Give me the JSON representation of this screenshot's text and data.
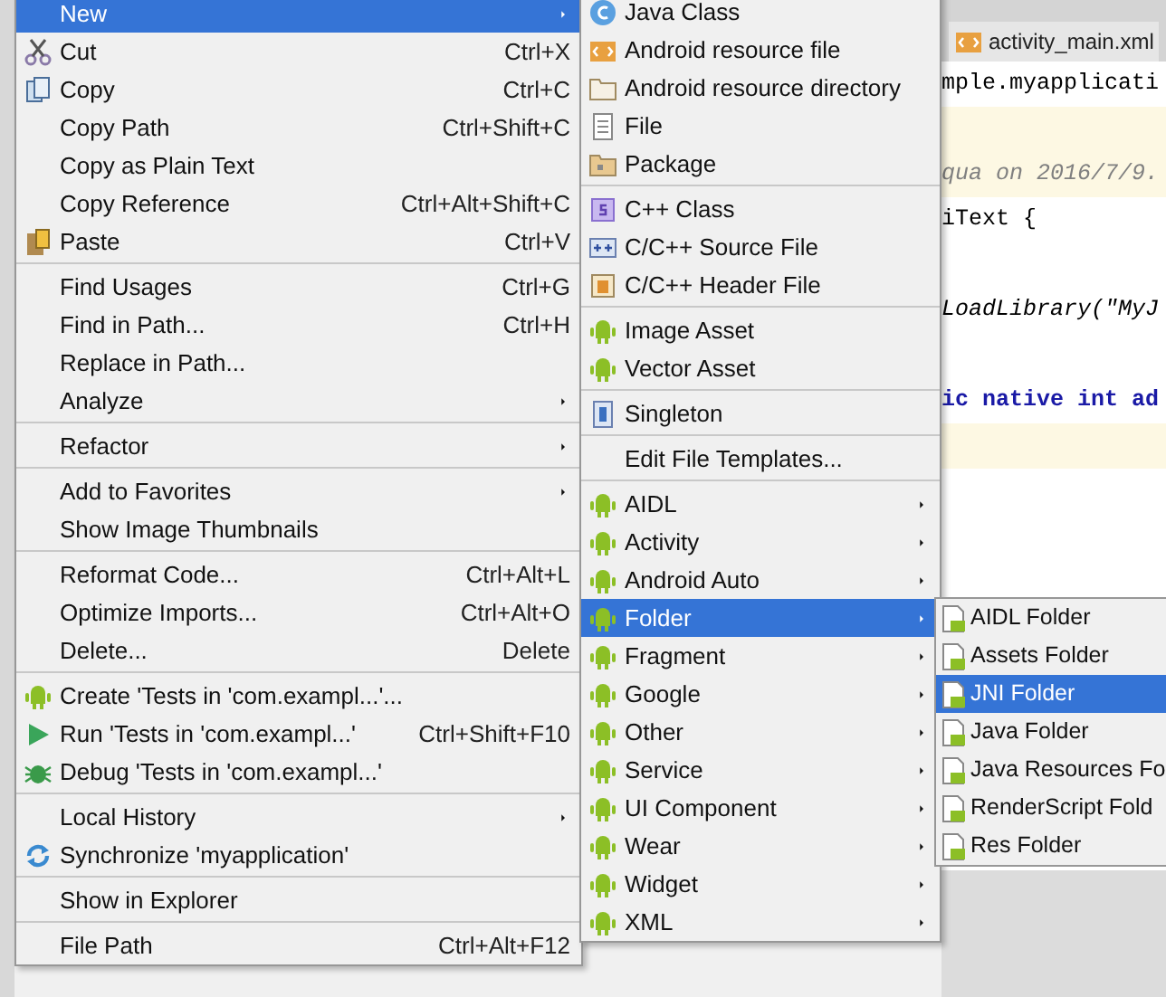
{
  "editor": {
    "tab": "activity_main.xml",
    "lines": [
      {
        "kind": "code",
        "text": "mple.myapplicati"
      },
      {
        "kind": "blank_highlight"
      },
      {
        "kind": "comment",
        "text": "qua on 2016/7/9."
      },
      {
        "kind": "code",
        "text": "iText {"
      },
      {
        "kind": "blank"
      },
      {
        "kind": "italic",
        "text": "LoadLibrary(\"MyJ"
      },
      {
        "kind": "blank"
      },
      {
        "kind": "keyword",
        "text": "ic native int ad"
      },
      {
        "kind": "blank_highlight"
      }
    ]
  },
  "context_menu": {
    "items": [
      {
        "kind": "item",
        "label": "New",
        "submenu": true,
        "selected": true
      },
      {
        "kind": "item",
        "label": "Cut",
        "shortcut": "Ctrl+X",
        "selected": false
      },
      {
        "kind": "item",
        "label": "Copy",
        "shortcut": "Ctrl+C",
        "selected": false
      },
      {
        "kind": "item",
        "label": "Copy Path",
        "shortcut": "Ctrl+Shift+C",
        "selected": false
      },
      {
        "kind": "item",
        "label": "Copy as Plain Text",
        "selected": false
      },
      {
        "kind": "item",
        "label": "Copy Reference",
        "shortcut": "Ctrl+Alt+Shift+C",
        "selected": false
      },
      {
        "kind": "item",
        "label": "Paste",
        "shortcut": "Ctrl+V",
        "selected": false
      },
      {
        "kind": "separator"
      },
      {
        "kind": "item",
        "label": "Find Usages",
        "shortcut": "Ctrl+G",
        "selected": false
      },
      {
        "kind": "item",
        "label": "Find in Path...",
        "shortcut": "Ctrl+H",
        "selected": false
      },
      {
        "kind": "item",
        "label": "Replace in Path...",
        "selected": false
      },
      {
        "kind": "item",
        "label": "Analyze",
        "submenu": true,
        "selected": false
      },
      {
        "kind": "separator"
      },
      {
        "kind": "item",
        "label": "Refactor",
        "submenu": true,
        "selected": false
      },
      {
        "kind": "separator"
      },
      {
        "kind": "item",
        "label": "Add to Favorites",
        "submenu": true,
        "selected": false
      },
      {
        "kind": "item",
        "label": "Show Image Thumbnails",
        "selected": false
      },
      {
        "kind": "separator"
      },
      {
        "kind": "item",
        "label": "Reformat Code...",
        "shortcut": "Ctrl+Alt+L",
        "selected": false
      },
      {
        "kind": "item",
        "label": "Optimize Imports...",
        "shortcut": "Ctrl+Alt+O",
        "selected": false
      },
      {
        "kind": "item",
        "label": "Delete...",
        "shortcut": "Delete",
        "selected": false
      },
      {
        "kind": "separator"
      },
      {
        "kind": "item",
        "label": "Create 'Tests in 'com.exampl...'...",
        "selected": false
      },
      {
        "kind": "item",
        "label": "Run 'Tests in 'com.exampl...'",
        "shortcut": "Ctrl+Shift+F10",
        "selected": false
      },
      {
        "kind": "item",
        "label": "Debug 'Tests in 'com.exampl...'",
        "selected": false
      },
      {
        "kind": "separator"
      },
      {
        "kind": "item",
        "label": "Local History",
        "submenu": true,
        "selected": false
      },
      {
        "kind": "item",
        "label": "Synchronize 'myapplication'",
        "selected": false
      },
      {
        "kind": "separator"
      },
      {
        "kind": "item",
        "label": "Show in Explorer",
        "selected": false
      },
      {
        "kind": "separator"
      },
      {
        "kind": "item",
        "label": "File Path",
        "shortcut": "Ctrl+Alt+F12",
        "selected": false
      }
    ]
  },
  "new_submenu": {
    "items": [
      {
        "kind": "item",
        "label": "Java Class",
        "selected": false
      },
      {
        "kind": "item",
        "label": "Android resource file",
        "selected": false
      },
      {
        "kind": "item",
        "label": "Android resource directory",
        "selected": false
      },
      {
        "kind": "item",
        "label": "File",
        "selected": false
      },
      {
        "kind": "item",
        "label": "Package",
        "selected": false
      },
      {
        "kind": "separator"
      },
      {
        "kind": "item",
        "label": "C++ Class",
        "selected": false
      },
      {
        "kind": "item",
        "label": "C/C++ Source File",
        "selected": false
      },
      {
        "kind": "item",
        "label": "C/C++ Header File",
        "selected": false
      },
      {
        "kind": "separator"
      },
      {
        "kind": "item",
        "label": "Image Asset",
        "selected": false
      },
      {
        "kind": "item",
        "label": "Vector Asset",
        "selected": false
      },
      {
        "kind": "separator"
      },
      {
        "kind": "item",
        "label": "Singleton",
        "selected": false
      },
      {
        "kind": "separator"
      },
      {
        "kind": "item",
        "label": "Edit File Templates...",
        "selected": false
      },
      {
        "kind": "separator"
      },
      {
        "kind": "item",
        "label": "AIDL",
        "submenu": true,
        "selected": false
      },
      {
        "kind": "item",
        "label": "Activity",
        "submenu": true,
        "selected": false
      },
      {
        "kind": "item",
        "label": "Android Auto",
        "submenu": true,
        "selected": false
      },
      {
        "kind": "item",
        "label": "Folder",
        "submenu": true,
        "selected": true
      },
      {
        "kind": "item",
        "label": "Fragment",
        "submenu": true,
        "selected": false
      },
      {
        "kind": "item",
        "label": "Google",
        "submenu": true,
        "selected": false
      },
      {
        "kind": "item",
        "label": "Other",
        "submenu": true,
        "selected": false
      },
      {
        "kind": "item",
        "label": "Service",
        "submenu": true,
        "selected": false
      },
      {
        "kind": "item",
        "label": "UI Component",
        "submenu": true,
        "selected": false
      },
      {
        "kind": "item",
        "label": "Wear",
        "submenu": true,
        "selected": false
      },
      {
        "kind": "item",
        "label": "Widget",
        "submenu": true,
        "selected": false
      },
      {
        "kind": "item",
        "label": "XML",
        "submenu": true,
        "selected": false
      }
    ]
  },
  "folder_submenu": {
    "items": [
      {
        "label": "AIDL Folder",
        "selected": false
      },
      {
        "label": "Assets Folder",
        "selected": false
      },
      {
        "label": "JNI Folder",
        "selected": true
      },
      {
        "label": "Java Folder",
        "selected": false
      },
      {
        "label": "Java Resources Fo",
        "selected": false
      },
      {
        "label": "RenderScript Fold",
        "selected": false
      },
      {
        "label": "Res Folder",
        "selected": false
      }
    ]
  }
}
